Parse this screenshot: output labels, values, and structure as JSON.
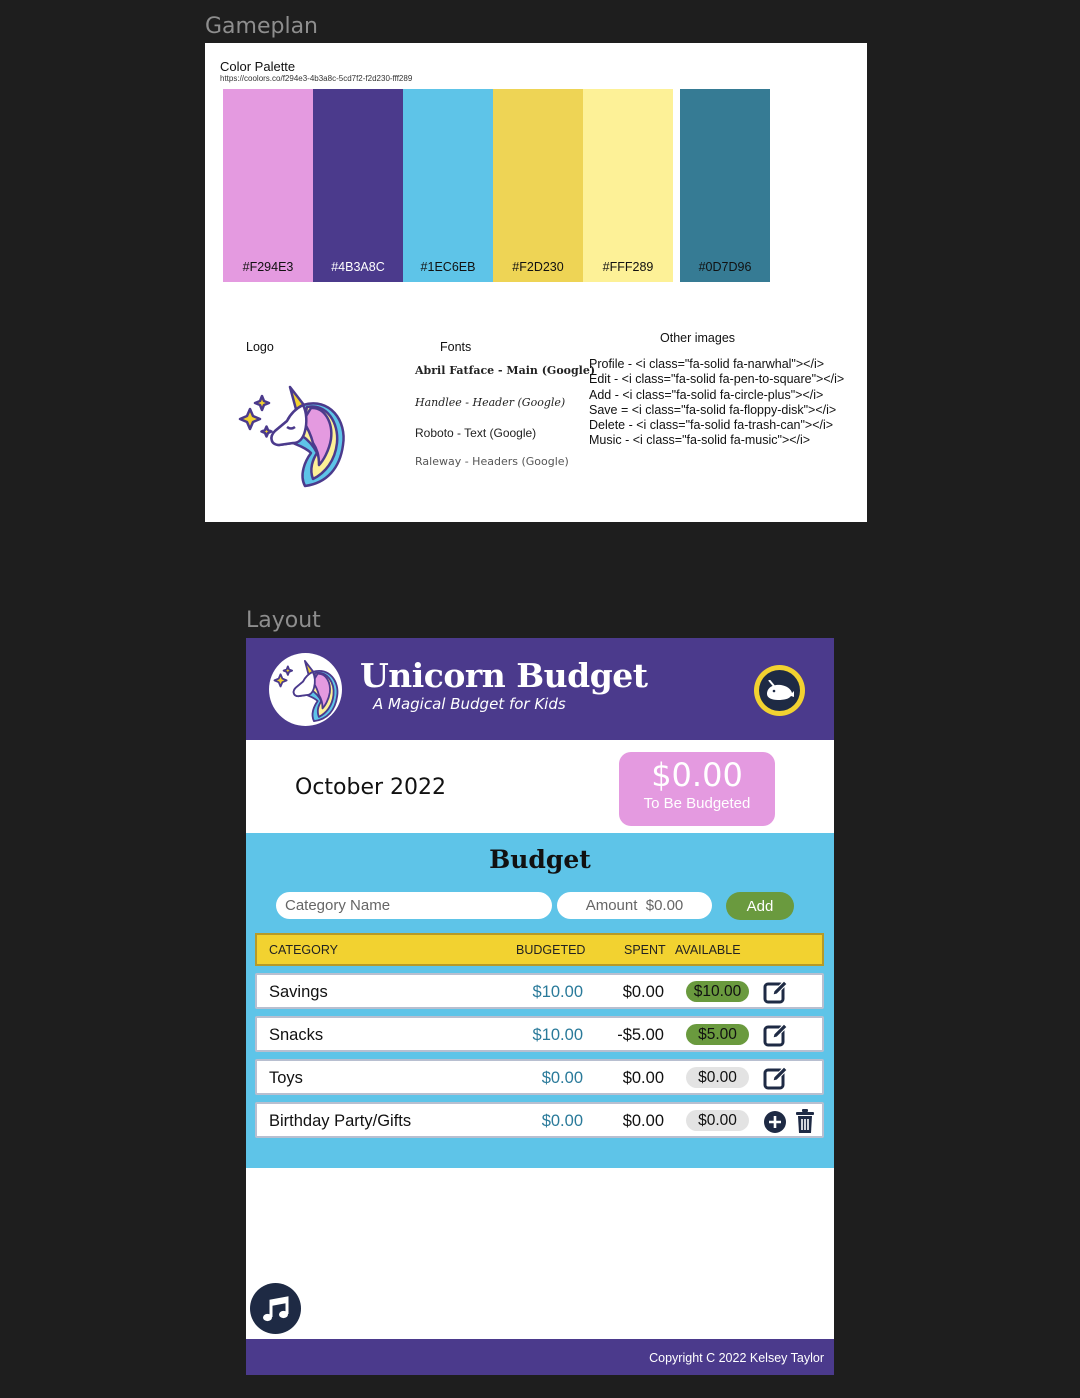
{
  "frames": {
    "gameplan_label": "Gameplan",
    "layout_label": "Layout"
  },
  "gameplan": {
    "palette_title": "Color Palette",
    "palette_url": "https://coolors.co/f294e3-4b3a8c-5cd7f2-f2d230-fff289",
    "swatches": [
      {
        "hex": "#F294E3",
        "color": "#e49ae0"
      },
      {
        "hex": "#4B3A8C",
        "color": "#4b3a8c"
      },
      {
        "hex": "#1EC6EB",
        "color": "#5ec4e8"
      },
      {
        "hex": "#F2D230",
        "color": "#eed455"
      },
      {
        "hex": "#FFF289",
        "color": "#fdf197"
      },
      {
        "hex": "#0D7D96",
        "color": "#367b94"
      }
    ],
    "logo_heading": "Logo",
    "fonts_heading": "Fonts",
    "fonts": [
      "Abril Fatface - Main (Google)",
      "Handlee - Header (Google)",
      "Roboto - Text (Google)",
      "Raleway - Headers (Google)"
    ],
    "other_heading": "Other images",
    "other_images": [
      "Profile - <i class=\"fa-solid fa-narwhal\"></i>",
      "Edit - <i class=\"fa-solid fa-pen-to-square\"></i>",
      "Add - <i class=\"fa-solid fa-circle-plus\"></i>",
      "Save = <i class=\"fa-solid fa-floppy-disk\"></i>",
      "Delete - <i class=\"fa-solid fa-trash-can\"></i>",
      "Music - <i class=\"fa-solid fa-music\"></i>"
    ]
  },
  "app": {
    "title": "Unicorn Budget",
    "subtitle": "A Magical Budget for Kids",
    "profile_icon": "narwhal-icon",
    "month": "October 2022",
    "to_be_budgeted": {
      "amount": "$0.00",
      "label": "To Be Budgeted"
    },
    "budget_title": "Budget",
    "form": {
      "category_placeholder": "Category Name",
      "amount_placeholder": "Amount  $0.00",
      "add_label": "Add"
    },
    "table_headers": {
      "category": "CATEGORY",
      "budgeted": "BUDGETED",
      "spent": "SPENT",
      "available": "AVAILABLE"
    },
    "rows": [
      {
        "category": "Savings",
        "budgeted": "$10.00",
        "spent": "$0.00",
        "available": "$10.00",
        "status": "positive",
        "actions": [
          "edit-icon"
        ]
      },
      {
        "category": "Snacks",
        "budgeted": "$10.00",
        "spent": "-$5.00",
        "available": "$5.00",
        "status": "positive",
        "actions": [
          "edit-icon"
        ]
      },
      {
        "category": "Toys",
        "budgeted": "$0.00",
        "spent": "$0.00",
        "available": "$0.00",
        "status": "zero",
        "actions": [
          "edit-icon"
        ]
      },
      {
        "category": "Birthday Party/Gifts",
        "budgeted": "$0.00",
        "spent": "$0.00",
        "available": "$0.00",
        "status": "zero",
        "actions": [
          "circle-plus-icon",
          "trash-can-icon"
        ]
      }
    ],
    "music_icon": "music-icon",
    "copyright": "Copyright C 2022 Kelsey Taylor"
  }
}
